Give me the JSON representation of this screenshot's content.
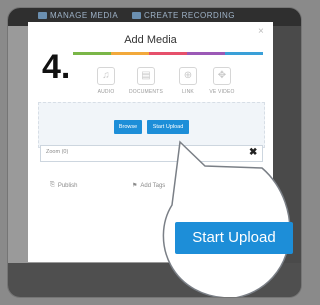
{
  "topbar": {
    "manage_media": "MANAGE MEDIA",
    "create_recording": "CREATE RECORDING"
  },
  "dialog": {
    "title": "Add Media",
    "close": "×",
    "step": "4.",
    "stripe_colors": [
      "#7ab648",
      "#f2a93b",
      "#e6506b",
      "#9b59b6",
      "#3aa0d8"
    ],
    "media_types": [
      {
        "icon": "music-note-icon",
        "glyph": "♫",
        "label": "AUDIO"
      },
      {
        "icon": "document-icon",
        "glyph": "▤",
        "label": "DOCUMENTS"
      },
      {
        "icon": "globe-icon",
        "glyph": "⊕",
        "label": "LINK"
      },
      {
        "icon": "video-icon",
        "glyph": "✥",
        "label": "VE VIDEO"
      }
    ],
    "browse_label": "Browse",
    "start_upload_label": "Start Upload",
    "file_name": "Zoom (0)",
    "remove_glyph": "✖",
    "publish_label": "Publish",
    "add_tags_label": "Add Tags"
  },
  "magnified": {
    "start_upload_label": "Start Upload"
  }
}
